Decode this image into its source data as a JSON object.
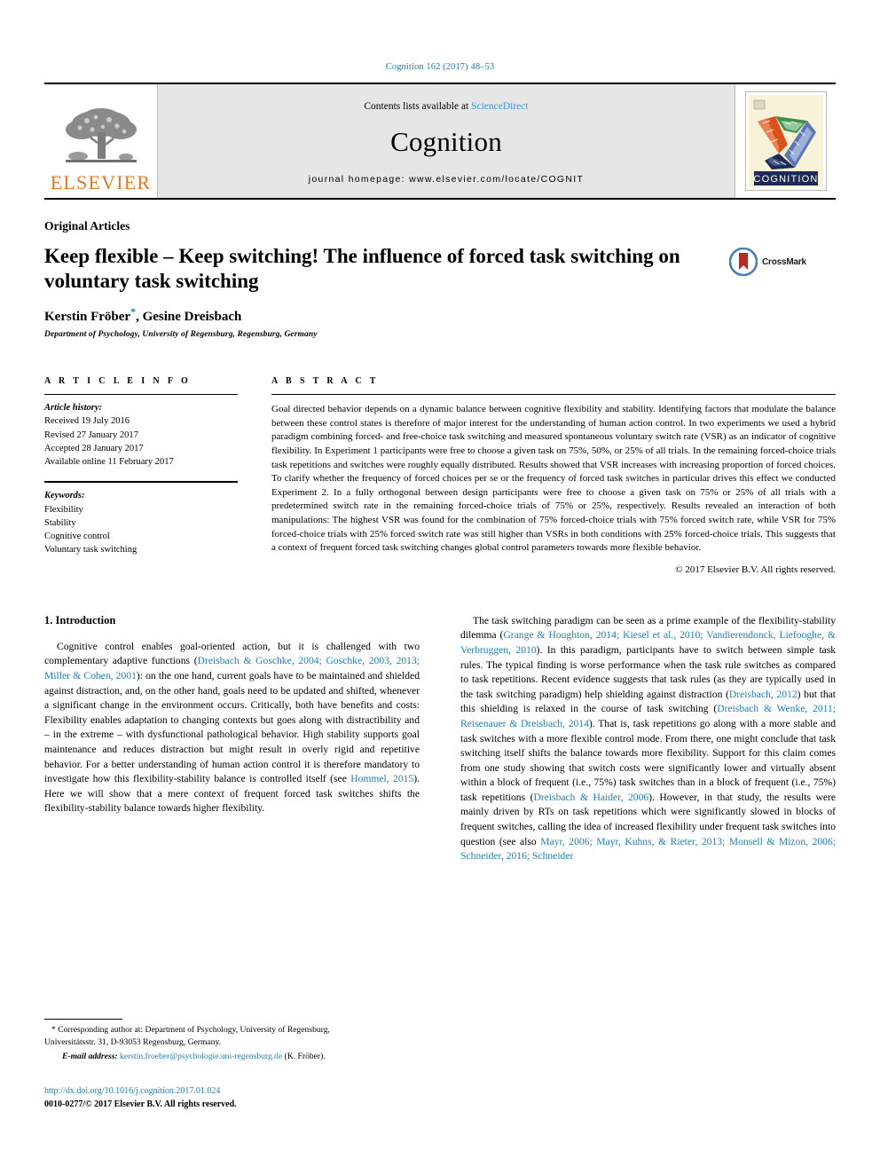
{
  "running_head": "Cognition 162 (2017) 48–53",
  "masthead": {
    "publisher_logo_name": "elsevier-logo",
    "publisher_wordmark": "ELSEVIER",
    "contents_prefix": "Contents lists available at",
    "contents_link": "ScienceDirect",
    "journal_name": "Cognition",
    "homepage": "journal homepage: www.elsevier.com/locate/COGNIT",
    "cover_title": "COGNITION"
  },
  "article": {
    "kind": "Original Articles",
    "title": "Keep flexible – Keep switching! The influence of forced task switching on voluntary task switching",
    "crossmark_label": "CrossMark",
    "authors": "Kerstin Fröber",
    "authors_rest": ", Gesine Dreisbach",
    "corresponding_marker": "*",
    "affiliation": "Department of Psychology, University of Regensburg, Regensburg, Germany"
  },
  "info": {
    "heading": "A R T I C L E  I N F O",
    "history_label": "Article history:",
    "history": [
      "Received 19 July 2016",
      "Revised 27 January 2017",
      "Accepted 28 January 2017",
      "Available online 11 February 2017"
    ],
    "keywords_label": "Keywords:",
    "keywords": [
      "Flexibility",
      "Stability",
      "Cognitive control",
      "Voluntary task switching"
    ]
  },
  "abstract": {
    "heading": "A B S T R A C T",
    "text": "Goal directed behavior depends on a dynamic balance between cognitive flexibility and stability. Identifying factors that modulate the balance between these control states is therefore of major interest for the understanding of human action control. In two experiments we used a hybrid paradigm combining forced- and free-choice task switching and measured spontaneous voluntary switch rate (VSR) as an indicator of cognitive flexibility. In Experiment 1 participants were free to choose a given task on 75%, 50%, or 25% of all trials. In the remaining forced-choice trials task repetitions and switches were roughly equally distributed. Results showed that VSR increases with increasing proportion of forced choices. To clarify whether the frequency of forced choices per se or the frequency of forced task switches in particular drives this effect we conducted Experiment 2. In a fully orthogonal between design participants were free to choose a given task on 75% or 25% of all trials with a predetermined switch rate in the remaining forced-choice trials of 75% or 25%, respectively. Results revealed an interaction of both manipulations: The highest VSR was found for the combination of 75% forced-choice trials with 75% forced switch rate, while VSR for 75% forced-choice trials with 25% forced switch rate was still higher than VSRs in both conditions with 25% forced-choice trials. This suggests that a context of frequent forced task switching changes global control parameters towards more flexible behavior.",
    "copyright": "© 2017 Elsevier B.V. All rights reserved."
  },
  "body": {
    "section_heading": "1. Introduction",
    "left_paragraph": {
      "seg1": "Cognitive control enables goal-oriented action, but it is challenged with two complementary adaptive functions (",
      "ref1": "Dreisbach & Goschke, 2004; Goschke, 2003, 2013; Miller & Cohen, 2001",
      "seg2": "): on the one hand, current goals have to be maintained and shielded against distraction, and, on the other hand, goals need to be updated and shifted, whenever a significant change in the environment occurs. Critically, both have benefits and costs: Flexibility enables adaptation to changing contexts but goes along with distractibility and – in the extreme – with dysfunctional pathological behavior. High stability supports goal maintenance and reduces distraction but might result in overly rigid and repetitive behavior. For a better understanding of human action control it is therefore mandatory to investigate how this flexibility-stability balance is controlled itself (see ",
      "ref2": "Hommel, 2015",
      "seg3": "). Here we will show that a mere context of frequent forced task switches shifts the flexibility-stability balance towards higher flexibility."
    },
    "right_paragraph": {
      "seg1": "The task switching paradigm can be seen as a prime example of the flexibility-stability dilemma (",
      "ref1": "Grange & Houghton, 2014; Kiesel et al., 2010; Vandierendonck, Liefooghe, & Verbruggen, 2010",
      "seg2": "). In this paradigm, participants have to switch between simple task rules. The typical finding is worse performance when the task rule switches as compared to task repetitions. Recent evidence suggests that task rules (as they are typically used in the task switching paradigm) help shielding against distraction (",
      "ref2": "Dreisbach, 2012",
      "seg3": ") but that this shielding is relaxed in the course of task switching (",
      "ref3": "Dreisbach & Wenke, 2011; Reisenauer & Dreisbach, 2014",
      "seg4": "). That is, task repetitions go along with a more stable and task switches with a more flexible control mode. From there, one might conclude that task switching itself shifts the balance towards more flexibility. Support for this claim comes from one study showing that switch costs were significantly lower and virtually absent within a block of frequent (i.e., 75%) task switches than in a block of frequent (i.e., 75%) task repetitions (",
      "ref4": "Dreisbach & Haider, 2006",
      "seg5": "). However, in that study, the results were mainly driven by RTs on task repetitions which were significantly slowed in blocks of frequent switches, calling the idea of increased flexibility under frequent task switches into question (see also ",
      "ref5": "Mayr, 2006; Mayr, Kuhns, & Rieter, 2013; Monsell & Mizon, 2006; Schneider, 2016; Schneider"
    }
  },
  "footnote": {
    "marker": "*",
    "line1": "Corresponding author at: Department of Psychology, University of Regensburg,",
    "line2": "Universitätsstr. 31, D-93053 Regensburg, Germany.",
    "email_label": "E-mail address:",
    "email": "kerstin.froeber@psychologie.uni-regensburg.de",
    "email_suffix": "(K. Fröber)."
  },
  "imprint": {
    "doi": "http://dx.doi.org/10.1016/j.cognition.2017.01.024",
    "issn_line": "0010-0277/© 2017 Elsevier B.V. All rights reserved."
  },
  "colors": {
    "link": "#1f7fb6",
    "sciencedirect": "#3a9bd9",
    "elsevier_orange": "#e87722",
    "masthead_bg": "#e6e6e6"
  }
}
